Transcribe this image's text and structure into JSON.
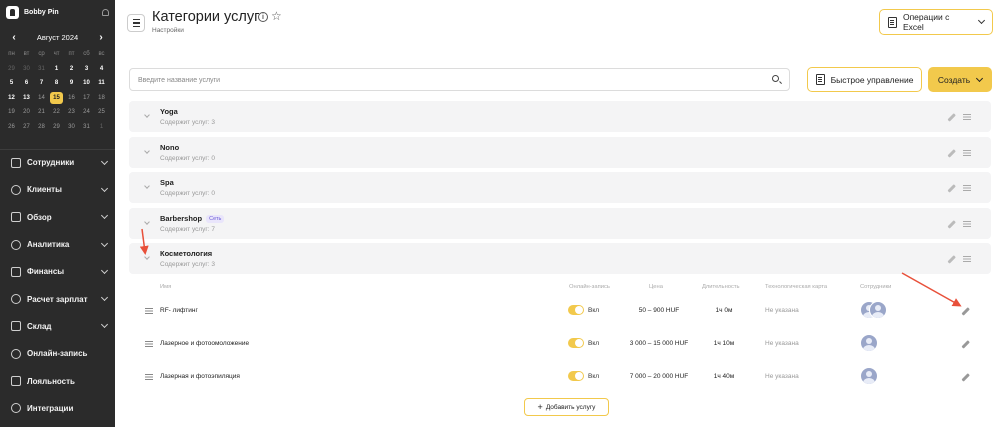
{
  "brand": {
    "name": "Bobby Pin"
  },
  "calendar": {
    "month_label": "Август 2024",
    "weekdays": [
      "пн",
      "вт",
      "ср",
      "чт",
      "пт",
      "сб",
      "вс"
    ],
    "days": [
      {
        "d": "29",
        "t": "out"
      },
      {
        "d": "30",
        "t": "out"
      },
      {
        "d": "31",
        "t": "out"
      },
      {
        "d": "1",
        "t": "cur"
      },
      {
        "d": "2",
        "t": "cur"
      },
      {
        "d": "3",
        "t": "cur"
      },
      {
        "d": "4",
        "t": "cur"
      },
      {
        "d": "5",
        "t": "cur"
      },
      {
        "d": "6",
        "t": "cur"
      },
      {
        "d": "7",
        "t": "cur"
      },
      {
        "d": "8",
        "t": "cur"
      },
      {
        "d": "9",
        "t": "cur"
      },
      {
        "d": "10",
        "t": "cur"
      },
      {
        "d": "11",
        "t": "cur"
      },
      {
        "d": "12",
        "t": "cur"
      },
      {
        "d": "13",
        "t": "cur"
      },
      {
        "d": "14",
        "t": "muted"
      },
      {
        "d": "15",
        "t": "today"
      },
      {
        "d": "16",
        "t": "muted"
      },
      {
        "d": "17",
        "t": "muted"
      },
      {
        "d": "18",
        "t": "muted"
      },
      {
        "d": "19",
        "t": "muted"
      },
      {
        "d": "20",
        "t": "muted"
      },
      {
        "d": "21",
        "t": "muted"
      },
      {
        "d": "22",
        "t": "muted"
      },
      {
        "d": "23",
        "t": "muted"
      },
      {
        "d": "24",
        "t": "muted"
      },
      {
        "d": "25",
        "t": "muted"
      },
      {
        "d": "26",
        "t": "muted"
      },
      {
        "d": "27",
        "t": "muted"
      },
      {
        "d": "28",
        "t": "muted"
      },
      {
        "d": "29",
        "t": "muted"
      },
      {
        "d": "30",
        "t": "muted"
      },
      {
        "d": "31",
        "t": "muted"
      },
      {
        "d": "1",
        "t": "out"
      }
    ]
  },
  "nav": [
    {
      "label": "Сотрудники",
      "icon": "users-icon",
      "chevron": true
    },
    {
      "label": "Клиенты",
      "icon": "clients-icon",
      "chevron": true
    },
    {
      "label": "Обзор",
      "icon": "overview-icon",
      "chevron": true
    },
    {
      "label": "Аналитика",
      "icon": "analytics-icon",
      "chevron": true
    },
    {
      "label": "Финансы",
      "icon": "finance-icon",
      "chevron": true
    },
    {
      "label": "Расчет зарплат",
      "icon": "payroll-icon",
      "chevron": true
    },
    {
      "label": "Склад",
      "icon": "warehouse-icon",
      "chevron": true
    },
    {
      "label": "Онлайн-запись",
      "icon": "online-booking-icon",
      "chevron": false
    },
    {
      "label": "Лояльность",
      "icon": "loyalty-icon",
      "chevron": false
    },
    {
      "label": "Интеграции",
      "icon": "integrations-icon",
      "chevron": false
    }
  ],
  "header": {
    "title": "Категории услуг",
    "subtitle": "Настройки",
    "excel_label": "Операции с Excel"
  },
  "toolbar": {
    "search_placeholder": "Введите название услуги",
    "quick_label": "Быстрое управление",
    "create_label": "Создать"
  },
  "categories": [
    {
      "name": "Yoga",
      "count": "Содержит услуг: 3",
      "badge": ""
    },
    {
      "name": "Nono",
      "count": "Содержит услуг: 0",
      "badge": ""
    },
    {
      "name": "Spa",
      "count": "Содержит услуг: 0",
      "badge": ""
    },
    {
      "name": "Barbershop",
      "count": "Содержит услуг: 7",
      "badge": "Сеть"
    },
    {
      "name": "Косметология",
      "count": "Содержит услуг: 3",
      "badge": ""
    }
  ],
  "table": {
    "headers": {
      "name": "Имя",
      "online": "Онлайн-запись",
      "price": "Цена",
      "duration": "Длительность",
      "tech": "Технологическая карта",
      "staff": "Сотрудники"
    },
    "rows": [
      {
        "name": "RF- лифтинг",
        "online": "Вкл",
        "price": "50 – 900 HUF",
        "duration": "1ч 0м",
        "tech": "Не указана",
        "staff_count": 2
      },
      {
        "name": "Лазерное и фотоомоложение",
        "online": "Вкл",
        "price": "3 000 – 15 000 HUF",
        "duration": "1ч 10м",
        "tech": "Не указана",
        "staff_count": 1
      },
      {
        "name": "Лазерная и фотоэпиляция",
        "online": "Вкл",
        "price": "7 000 – 20 000 HUF",
        "duration": "1ч 40м",
        "tech": "Не указана",
        "staff_count": 1
      }
    ],
    "add_label": "Добавить услугу"
  },
  "colors": {
    "accent": "#f2c94c",
    "sidebar": "#2b2b2b",
    "annotation": "#e8503a"
  }
}
